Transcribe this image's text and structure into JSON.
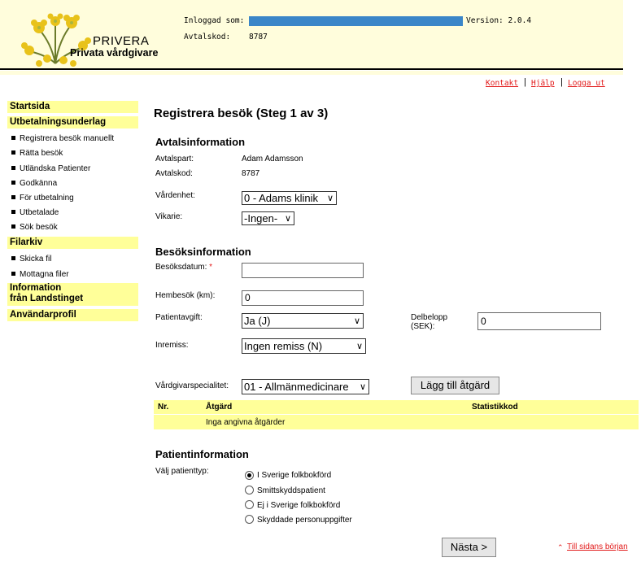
{
  "header": {
    "brand_name": "PRIVERA",
    "brand_sub": "Privata vårdgivare",
    "logged_in_label": "Inloggad som:",
    "agreement_code_label": "Avtalskod:",
    "agreement_code_value": "8787",
    "version": "Version: 2.0.4"
  },
  "toplinks": {
    "contact": "Kontakt",
    "help": "Hjälp",
    "logout": "Logga ut",
    "separator": "|"
  },
  "sidebar": {
    "startpage": "Startsida",
    "payment_basis": "Utbetalningsunderlag",
    "payment_items": [
      "Registrera besök manuellt",
      "Rätta besök",
      "Utländska Patienter",
      "Godkänna",
      "För utbetalning",
      "Utbetalade",
      "Sök besök"
    ],
    "file_archive": "Filarkiv",
    "file_items": [
      "Skicka fil",
      "Mottagna filer"
    ],
    "info_line1": "Information",
    "info_line2": "från Landstinget",
    "user_profile": "Användarprofil"
  },
  "main": {
    "title": "Registrera besök (Steg 1 av 3)",
    "agreement": {
      "heading": "Avtalsinformation",
      "party_label": "Avtalspart:",
      "party_value": "Adam Adamsson",
      "code_label": "Avtalskod:",
      "code_value": "8787",
      "unit_label": "Vårdenhet:",
      "unit_value": "0 - Adams klinik",
      "substitute_label": "Vikarie:",
      "substitute_value": "-Ingen-"
    },
    "visit": {
      "heading": "Besöksinformation",
      "date_label": "Besöksdatum:",
      "required_mark": "*",
      "date_value": "",
      "home_visit_label": "Hembesök (km):",
      "home_visit_value": "0",
      "patient_fee_label": "Patientavgift:",
      "patient_fee_value": "Ja (J)",
      "partial_label_1": "Delbelopp",
      "partial_label_2": "(SEK):",
      "partial_value": "0",
      "referral_label": "Inremiss:",
      "referral_value": "Ingen remiss (N)",
      "specialty_label": "Vårdgivarspecialitet:",
      "specialty_value": "01 - Allmänmedicinare",
      "add_measure_button": "Lägg till åtgärd"
    },
    "measures_table": {
      "columns": [
        "Nr.",
        "Åtgärd",
        "Statistikkod"
      ],
      "empty_text": "Inga angivna åtgärder"
    },
    "patient": {
      "heading": "Patientinformation",
      "type_label": "Välj patienttyp:",
      "options": [
        "I Sverige folkbokförd",
        "Smittskyddspatient",
        "Ej i Sverige folkbokförd",
        "Skyddade personuppgifter"
      ],
      "selected_index": 0
    },
    "next_button": "Nästa >",
    "back_to_top_icon": "double-chevron-up-icon",
    "back_to_top": "Till sidans början"
  }
}
